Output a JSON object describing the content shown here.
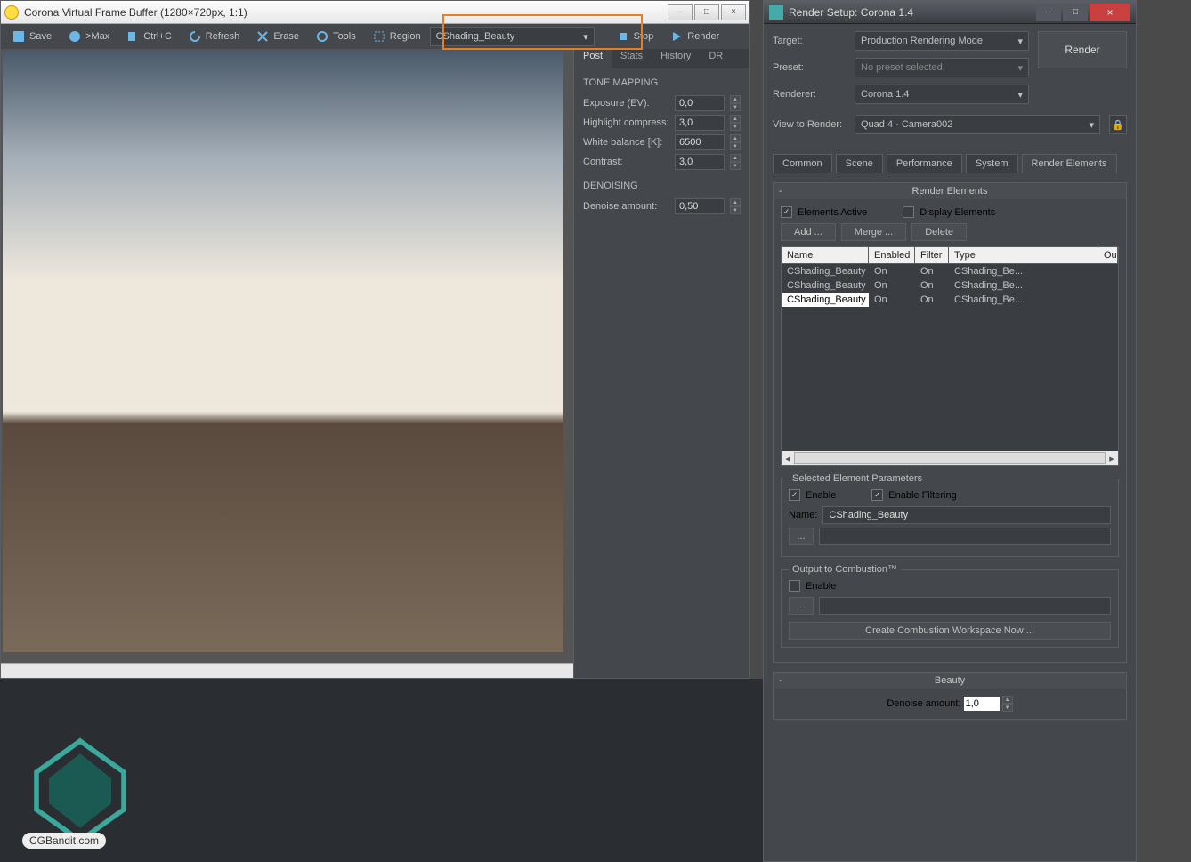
{
  "vfb": {
    "title": "Corona Virtual Frame Buffer (1280×720px, 1:1)",
    "toolbar": {
      "save": "Save",
      "max": ">Max",
      "ctrlc": "Ctrl+C",
      "refresh": "Refresh",
      "erase": "Erase",
      "tools": "Tools",
      "region": "Region",
      "channel": "CShading_Beauty",
      "stop": "Stop",
      "render": "Render"
    },
    "subtabs": {
      "post": "Post",
      "stats": "Stats",
      "history": "History",
      "dr": "DR"
    },
    "tone": {
      "title": "TONE MAPPING",
      "exposure_label": "Exposure (EV):",
      "exposure": "0,0",
      "highlight_label": "Highlight compress:",
      "highlight": "3,0",
      "wb_label": "White balance [K]:",
      "wb": "6500",
      "contrast_label": "Contrast:",
      "contrast": "3,0"
    },
    "denoise": {
      "title": "DENOISING",
      "amount_label": "Denoise amount:",
      "amount": "0,50"
    }
  },
  "rs": {
    "title": "Render Setup: Corona 1.4",
    "target_label": "Target:",
    "target": "Production Rendering Mode",
    "preset_label": "Preset:",
    "preset": "No preset selected",
    "renderer_label": "Renderer:",
    "renderer": "Corona 1.4",
    "view_label": "View to Render:",
    "view": "Quad 4 - Camera002",
    "render_btn": "Render",
    "tabs": {
      "common": "Common",
      "scene": "Scene",
      "performance": "Performance",
      "system": "System",
      "elements": "Render Elements"
    },
    "elements": {
      "title": "Render Elements",
      "active": "Elements Active",
      "display": "Display Elements",
      "add": "Add ...",
      "merge": "Merge ...",
      "delete": "Delete",
      "cols": {
        "name": "Name",
        "enabled": "Enabled",
        "filter": "Filter",
        "type": "Type",
        "out": "Ou"
      },
      "rows": [
        {
          "name": "CShading_Beauty",
          "enabled": "On",
          "filter": "On",
          "type": "CShading_Be..."
        },
        {
          "name": "CShading_Beauty",
          "enabled": "On",
          "filter": "On",
          "type": "CShading_Be..."
        },
        {
          "name": "CShading_Beauty",
          "enabled": "On",
          "filter": "On",
          "type": "CShading_Be..."
        }
      ]
    },
    "selparams": {
      "legend": "Selected Element Parameters",
      "enable": "Enable",
      "enable_filter": "Enable Filtering",
      "name_label": "Name:",
      "name": "CShading_Beauty"
    },
    "combustion": {
      "legend": "Output to Combustion™",
      "enable": "Enable",
      "create": "Create Combustion Workspace Now ..."
    },
    "beauty": {
      "title": "Beauty",
      "denoise_label": "Denoise amount:",
      "denoise": "1,0"
    }
  },
  "watermark": "CGBandit.com",
  "colors": {
    "highlight": "#e67e22",
    "bg": "#44474c",
    "panel": "#3a3d42",
    "accent": "#6bb8e8"
  }
}
